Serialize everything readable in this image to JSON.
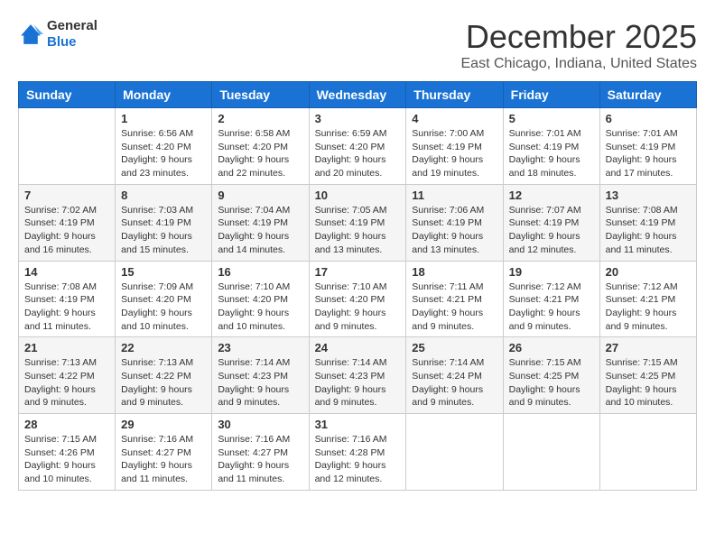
{
  "logo": {
    "line1": "General",
    "line2": "Blue"
  },
  "header": {
    "month": "December 2025",
    "location": "East Chicago, Indiana, United States"
  },
  "weekdays": [
    "Sunday",
    "Monday",
    "Tuesday",
    "Wednesday",
    "Thursday",
    "Friday",
    "Saturday"
  ],
  "weeks": [
    [
      {
        "day": "",
        "info": ""
      },
      {
        "day": "1",
        "info": "Sunrise: 6:56 AM\nSunset: 4:20 PM\nDaylight: 9 hours\nand 23 minutes."
      },
      {
        "day": "2",
        "info": "Sunrise: 6:58 AM\nSunset: 4:20 PM\nDaylight: 9 hours\nand 22 minutes."
      },
      {
        "day": "3",
        "info": "Sunrise: 6:59 AM\nSunset: 4:20 PM\nDaylight: 9 hours\nand 20 minutes."
      },
      {
        "day": "4",
        "info": "Sunrise: 7:00 AM\nSunset: 4:19 PM\nDaylight: 9 hours\nand 19 minutes."
      },
      {
        "day": "5",
        "info": "Sunrise: 7:01 AM\nSunset: 4:19 PM\nDaylight: 9 hours\nand 18 minutes."
      },
      {
        "day": "6",
        "info": "Sunrise: 7:01 AM\nSunset: 4:19 PM\nDaylight: 9 hours\nand 17 minutes."
      }
    ],
    [
      {
        "day": "7",
        "info": "Sunrise: 7:02 AM\nSunset: 4:19 PM\nDaylight: 9 hours\nand 16 minutes."
      },
      {
        "day": "8",
        "info": "Sunrise: 7:03 AM\nSunset: 4:19 PM\nDaylight: 9 hours\nand 15 minutes."
      },
      {
        "day": "9",
        "info": "Sunrise: 7:04 AM\nSunset: 4:19 PM\nDaylight: 9 hours\nand 14 minutes."
      },
      {
        "day": "10",
        "info": "Sunrise: 7:05 AM\nSunset: 4:19 PM\nDaylight: 9 hours\nand 13 minutes."
      },
      {
        "day": "11",
        "info": "Sunrise: 7:06 AM\nSunset: 4:19 PM\nDaylight: 9 hours\nand 13 minutes."
      },
      {
        "day": "12",
        "info": "Sunrise: 7:07 AM\nSunset: 4:19 PM\nDaylight: 9 hours\nand 12 minutes."
      },
      {
        "day": "13",
        "info": "Sunrise: 7:08 AM\nSunset: 4:19 PM\nDaylight: 9 hours\nand 11 minutes."
      }
    ],
    [
      {
        "day": "14",
        "info": "Sunrise: 7:08 AM\nSunset: 4:19 PM\nDaylight: 9 hours\nand 11 minutes."
      },
      {
        "day": "15",
        "info": "Sunrise: 7:09 AM\nSunset: 4:20 PM\nDaylight: 9 hours\nand 10 minutes."
      },
      {
        "day": "16",
        "info": "Sunrise: 7:10 AM\nSunset: 4:20 PM\nDaylight: 9 hours\nand 10 minutes."
      },
      {
        "day": "17",
        "info": "Sunrise: 7:10 AM\nSunset: 4:20 PM\nDaylight: 9 hours\nand 9 minutes."
      },
      {
        "day": "18",
        "info": "Sunrise: 7:11 AM\nSunset: 4:21 PM\nDaylight: 9 hours\nand 9 minutes."
      },
      {
        "day": "19",
        "info": "Sunrise: 7:12 AM\nSunset: 4:21 PM\nDaylight: 9 hours\nand 9 minutes."
      },
      {
        "day": "20",
        "info": "Sunrise: 7:12 AM\nSunset: 4:21 PM\nDaylight: 9 hours\nand 9 minutes."
      }
    ],
    [
      {
        "day": "21",
        "info": "Sunrise: 7:13 AM\nSunset: 4:22 PM\nDaylight: 9 hours\nand 9 minutes."
      },
      {
        "day": "22",
        "info": "Sunrise: 7:13 AM\nSunset: 4:22 PM\nDaylight: 9 hours\nand 9 minutes."
      },
      {
        "day": "23",
        "info": "Sunrise: 7:14 AM\nSunset: 4:23 PM\nDaylight: 9 hours\nand 9 minutes."
      },
      {
        "day": "24",
        "info": "Sunrise: 7:14 AM\nSunset: 4:23 PM\nDaylight: 9 hours\nand 9 minutes."
      },
      {
        "day": "25",
        "info": "Sunrise: 7:14 AM\nSunset: 4:24 PM\nDaylight: 9 hours\nand 9 minutes."
      },
      {
        "day": "26",
        "info": "Sunrise: 7:15 AM\nSunset: 4:25 PM\nDaylight: 9 hours\nand 9 minutes."
      },
      {
        "day": "27",
        "info": "Sunrise: 7:15 AM\nSunset: 4:25 PM\nDaylight: 9 hours\nand 10 minutes."
      }
    ],
    [
      {
        "day": "28",
        "info": "Sunrise: 7:15 AM\nSunset: 4:26 PM\nDaylight: 9 hours\nand 10 minutes."
      },
      {
        "day": "29",
        "info": "Sunrise: 7:16 AM\nSunset: 4:27 PM\nDaylight: 9 hours\nand 11 minutes."
      },
      {
        "day": "30",
        "info": "Sunrise: 7:16 AM\nSunset: 4:27 PM\nDaylight: 9 hours\nand 11 minutes."
      },
      {
        "day": "31",
        "info": "Sunrise: 7:16 AM\nSunset: 4:28 PM\nDaylight: 9 hours\nand 12 minutes."
      },
      {
        "day": "",
        "info": ""
      },
      {
        "day": "",
        "info": ""
      },
      {
        "day": "",
        "info": ""
      }
    ]
  ]
}
